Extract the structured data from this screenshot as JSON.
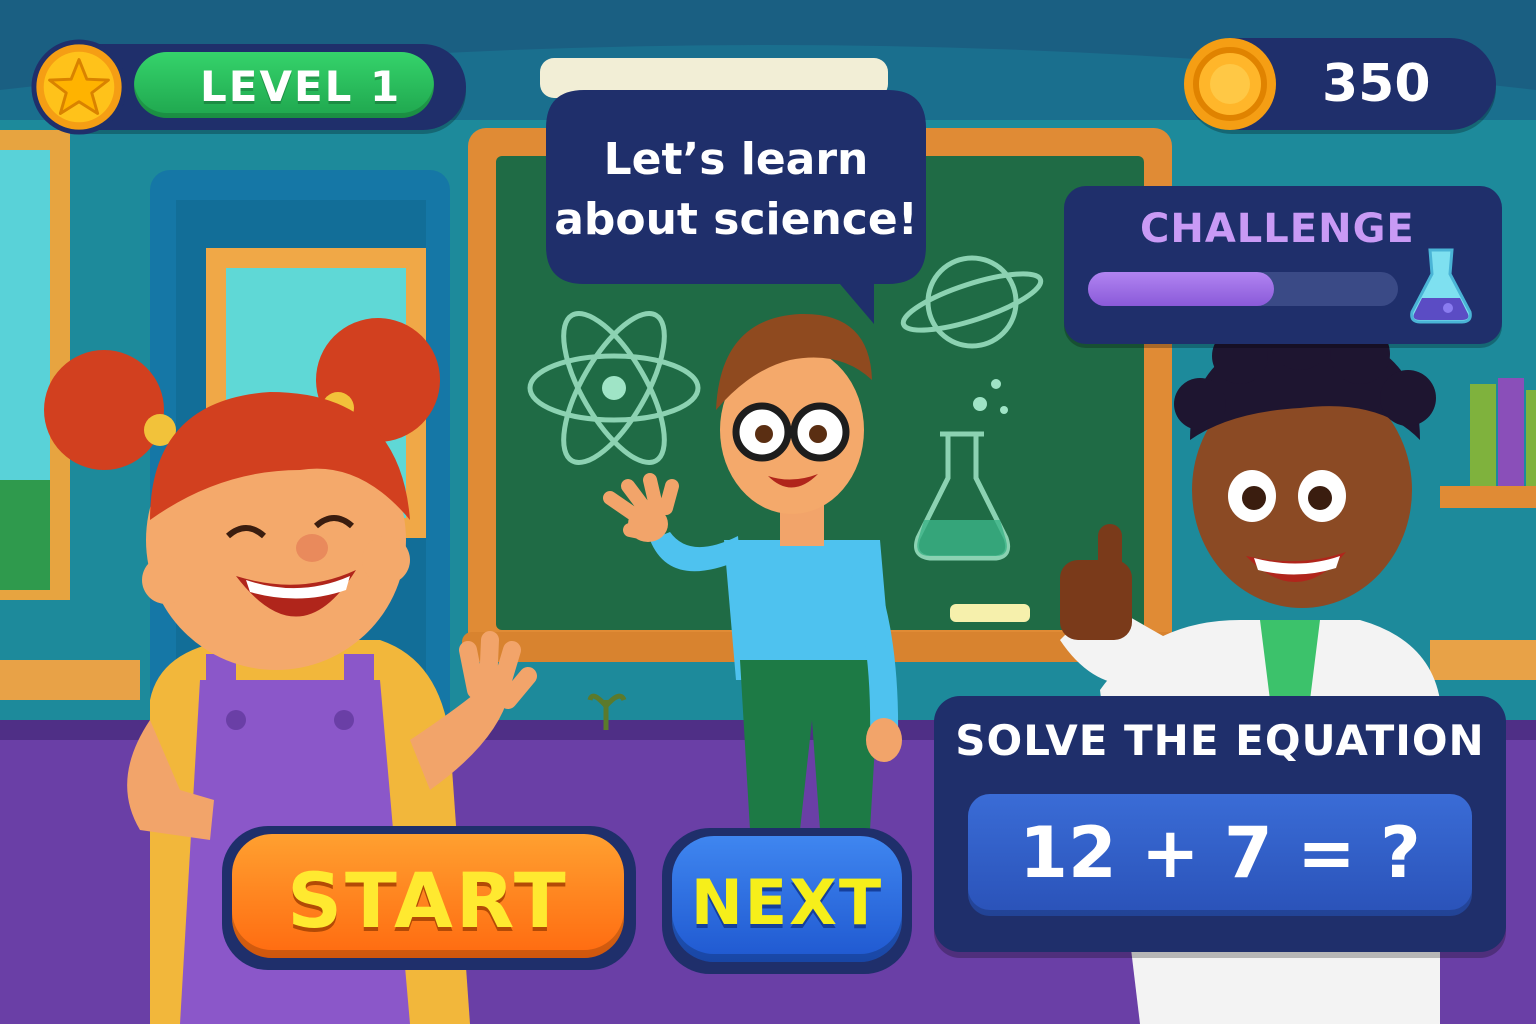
{
  "hud": {
    "level_label": "LEVEL 1",
    "coins": "350",
    "icons": {
      "level": "star-icon",
      "coins": "coin-icon",
      "challenge": "flask-icon"
    }
  },
  "speech": {
    "line1": "Let’s learn",
    "line2": "about science!"
  },
  "challenge": {
    "title": "CHALLENGE",
    "progress": 0.6
  },
  "equation": {
    "title": "SOLVE THE EQUATION",
    "expression": "12 + 7 = ?"
  },
  "buttons": {
    "start": "START",
    "next": "NEXT"
  },
  "colors": {
    "panel": "#1f2f6b",
    "level_green": "#1fa64e",
    "challenge_purple": "#9b6de6",
    "start_orange": "#ff7a18",
    "next_blue": "#2a64d8",
    "button_text_yellow": "#ffe930"
  }
}
